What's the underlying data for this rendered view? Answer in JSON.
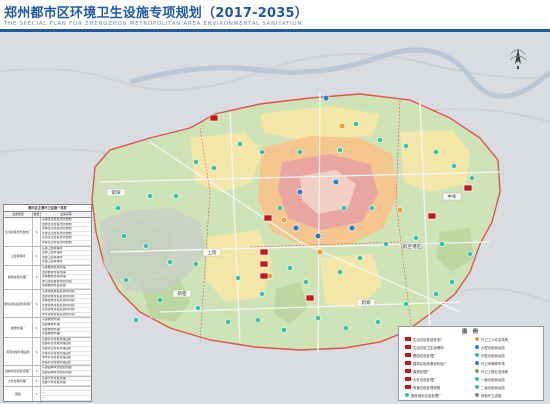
{
  "header": {
    "title": "郑州都市区环境卫生设施专项规划（2017-2035）",
    "subtitle": "THE SPECIAL PLAN FOR ZHENGZHOU METROPOLITAN AREA ENVIRONMENTAL SANITATION"
  },
  "colors": {
    "title_blue": "#1e5aa8",
    "base_map": "#d9dde2",
    "urban_green": "#c6e0a0",
    "urban_yellow": "#f3e7a8",
    "urban_orange": "#f5c78f",
    "urban_red": "#e9a6a0",
    "facility_teal": "#2fc4a8",
    "facility_red": "#c8161d",
    "boundary_red": "#e0554a"
  },
  "district_labels": [
    "荥阳",
    "上街",
    "新密",
    "新郑",
    "中牟",
    "航空港区"
  ],
  "legend": {
    "title": "图 例",
    "items": [
      "生活垃圾焚烧发电厂",
      "生活垃圾卫生填埋场",
      "餐厨垃圾处理厂",
      "建筑垃圾资源化利用厂",
      "粪便处理厂",
      "大件垃圾处理厂",
      "有害垃圾处理设施",
      "园林绿化垃圾处理厂",
      "环卫工人作息场所",
      "大型垃圾转运站",
      "中型垃圾转运站",
      "环卫车辆停车场",
      "环卫工程业务用房",
      "一级垃圾转运站",
      "二级垃圾转运站",
      "其他环卫设施"
    ]
  },
  "table": {
    "title": "都市区主要环卫设施一览表",
    "headers": [
      "设施类型",
      "数量",
      "设施名称"
    ],
    "groups": [
      {
        "category": "生活垃圾焚烧发电厂",
        "count": "6",
        "names": [
          "东部生活垃圾焚烧发电厂",
          "西部生活垃圾焚烧发电厂",
          "南部生活垃圾焚烧发电厂",
          "北部生活垃圾焚烧发电厂",
          "荥阳生活垃圾焚烧发电厂",
          "新郑生活垃圾焚烧发电厂"
        ]
      },
      {
        "category": "卫生填埋场",
        "count": "4",
        "names": [
          "东部卫生填埋场",
          "西部卫生填埋场",
          "南部卫生填埋场",
          "北部卫生填埋场"
        ]
      },
      {
        "category": "餐厨垃圾处理厂",
        "count": "5",
        "names": [
          "东部餐厨垃圾处理厂",
          "西部餐厨垃圾处理厂",
          "南部餐厨垃圾处理厂",
          "航空港区餐厨垃圾处理厂",
          "新郑餐厨垃圾处理厂"
        ]
      },
      {
        "category": "建筑垃圾资源化利用厂",
        "count": "6",
        "names": [
          "东部建筑垃圾资源化利用厂",
          "西部建筑垃圾资源化利用厂",
          "南部建筑垃圾资源化利用厂",
          "北部建筑垃圾资源化利用厂",
          "荥阳建筑垃圾资源化利用厂",
          "中牟建筑垃圾资源化利用厂"
        ]
      },
      {
        "category": "粪便处理厂",
        "count": "4",
        "names": [
          "东部粪便处理厂",
          "西部粪便处理厂",
          "南部粪便处理厂",
          "北部粪便处理厂"
        ]
      },
      {
        "category": "有害垃圾处理设施",
        "count": "6",
        "names": [
          "东部有害垃圾处理设施",
          "西部有害垃圾处理设施",
          "南部有害垃圾处理设施",
          "北部有害垃圾处理设施",
          "中牟有害垃圾处理设施",
          "新郑有害垃圾处理设施"
        ]
      },
      {
        "category": "园林绿化垃圾处理厂",
        "count": "2",
        "names": [
          "东部园林绿化垃圾处理厂",
          "西部园林绿化垃圾处理厂"
        ]
      },
      {
        "category": "大件垃圾处理厂",
        "count": "2",
        "names": [
          "东部大件垃圾处理厂",
          "西部大件垃圾处理厂"
        ]
      },
      {
        "category": "其他",
        "count": "3",
        "names": [
          "—",
          "—",
          "—"
        ]
      }
    ]
  }
}
